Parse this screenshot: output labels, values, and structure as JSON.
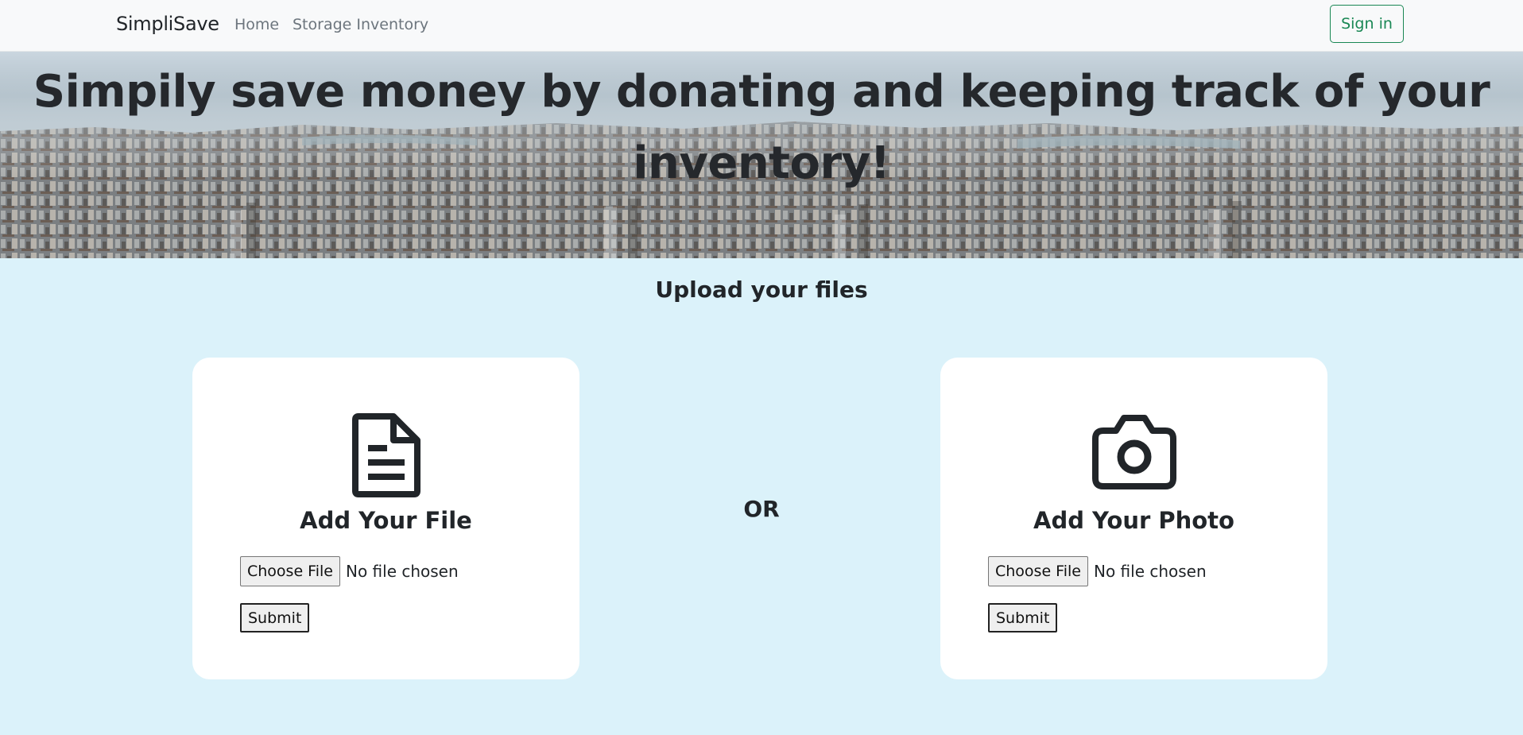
{
  "navbar": {
    "brand": "SimpliSave",
    "links": [
      {
        "label": "Home"
      },
      {
        "label": "Storage Inventory"
      }
    ],
    "signin_label": "Sign in",
    "signin_color": "#198754"
  },
  "hero": {
    "title": "Simpily save money by donating and keeping track of your inventory!"
  },
  "upload": {
    "heading": "Upload your files",
    "separator": "OR",
    "cards": [
      {
        "icon": "file-text-icon",
        "title": "Add Your File",
        "choose_label": "Choose File",
        "status": "No file chosen",
        "submit_label": "Submit"
      },
      {
        "icon": "camera-icon",
        "title": "Add Your Photo",
        "choose_label": "Choose File",
        "status": "No file chosen",
        "submit_label": "Submit"
      }
    ]
  },
  "colors": {
    "page_background": "#dbf2fa",
    "navbar_background": "#f8f9fa",
    "card_background": "#ffffff",
    "text": "#212529"
  }
}
